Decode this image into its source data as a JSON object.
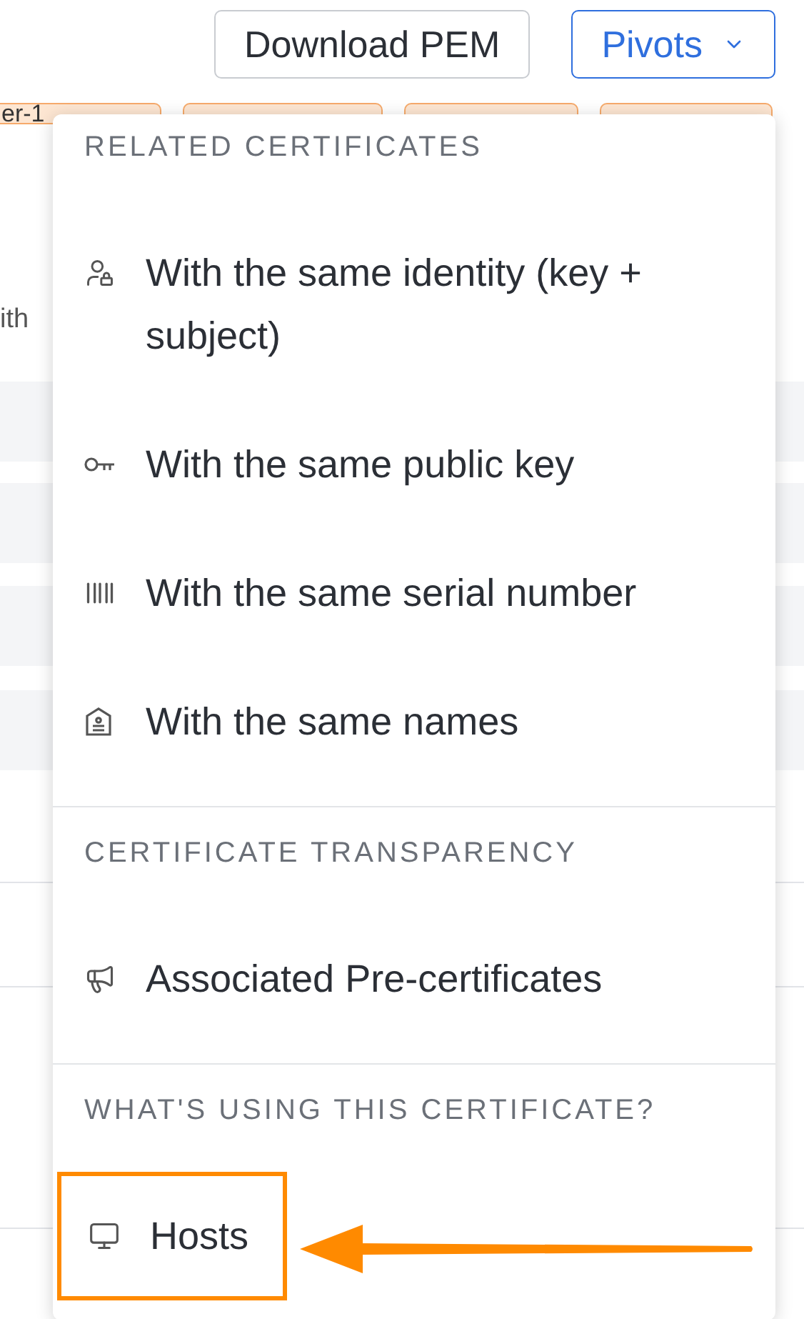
{
  "toolbar": {
    "buttons": [
      {
        "kind": "plain",
        "label": "Download PEM"
      },
      {
        "kind": "dropdown",
        "label": "Pivots",
        "expanded": true
      }
    ]
  },
  "tags": [
    {
      "label": "er-1"
    }
  ],
  "table": {
    "column_heading": "ith"
  },
  "pivots_menu": {
    "sections": [
      {
        "heading": "RELATED CERTIFICATES",
        "items": [
          {
            "kind": "identity",
            "label": "With the same identity (key + subject)",
            "highlighted": false
          },
          {
            "kind": "key",
            "label": "With the same public key",
            "highlighted": false
          },
          {
            "kind": "serial",
            "label": "With the same serial number",
            "highlighted": false
          },
          {
            "kind": "names",
            "label": "With the same names",
            "highlighted": false
          }
        ]
      },
      {
        "heading": "CERTIFICATE TRANSPARENCY",
        "items": [
          {
            "kind": "precert",
            "label": "Associated Pre-certificates",
            "highlighted": false
          }
        ]
      },
      {
        "heading": "WHAT'S USING THIS CERTIFICATE?",
        "items": [
          {
            "kind": "hosts",
            "label": "Hosts",
            "highlighted": true
          }
        ]
      }
    ]
  }
}
